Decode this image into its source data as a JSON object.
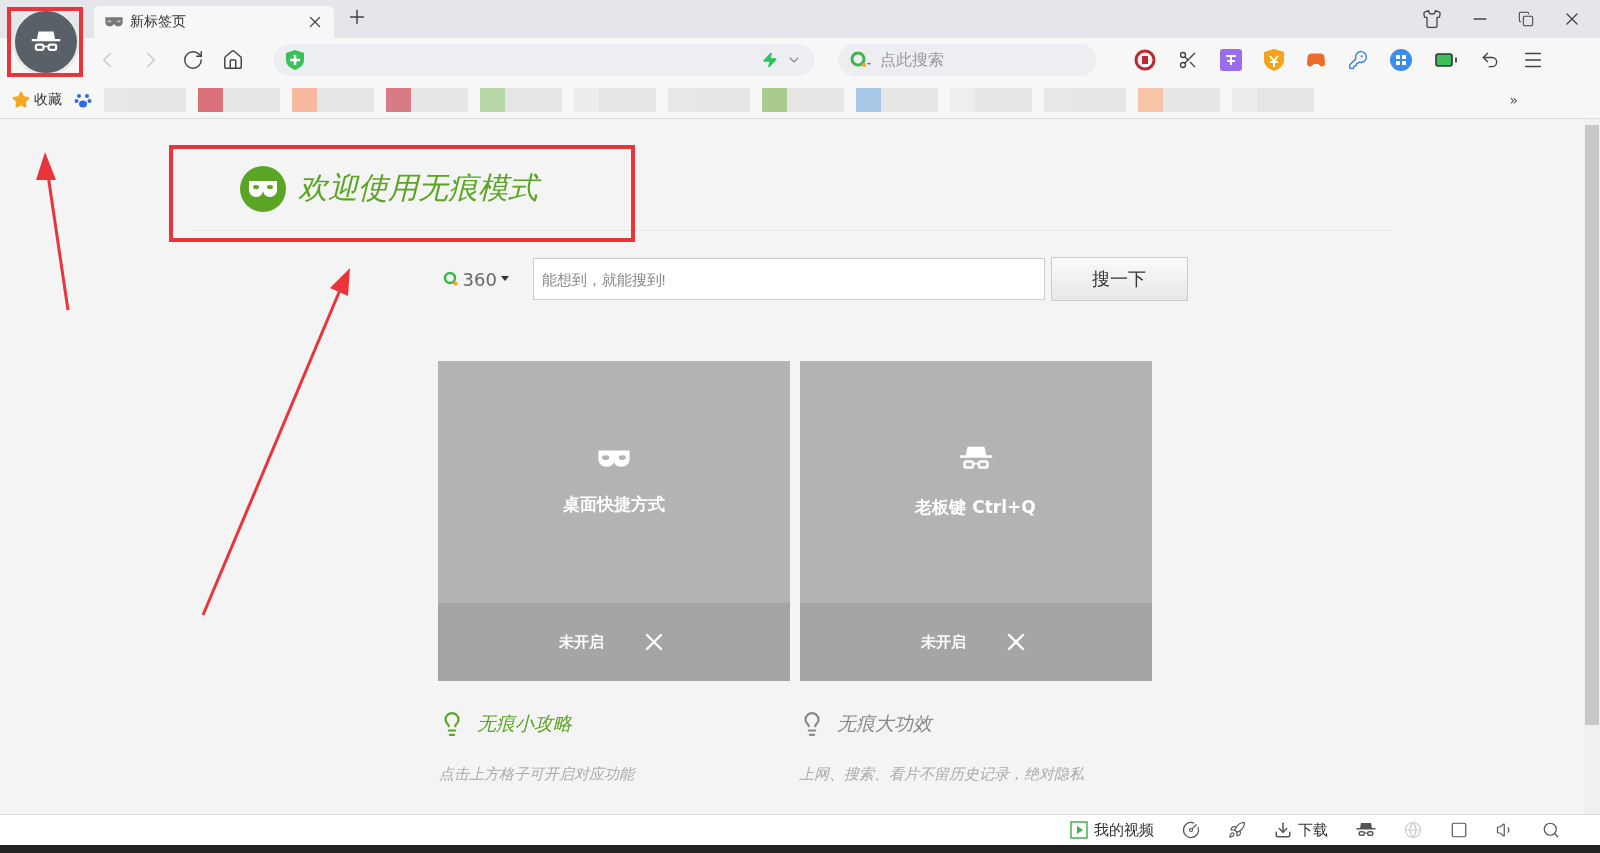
{
  "tab": {
    "title": "新标签页",
    "selected": true
  },
  "search_box": {
    "placeholder": "点此搜索"
  },
  "bookmarks_bar": {
    "favorites": "收藏",
    "more": "»"
  },
  "page": {
    "title": "欢迎使用无痕模式",
    "search": {
      "engine": "360",
      "placeholder": "能想到，就能搜到!",
      "button": "搜一下"
    },
    "tiles": [
      {
        "kind": "mask",
        "label": "桌面快捷方式",
        "status": "未开启",
        "on": false
      },
      {
        "kind": "boss",
        "label": "老板键 Ctrl+Q",
        "status": "未开启",
        "on": false
      }
    ],
    "tips": [
      {
        "title": "无痕小攻略",
        "color": "#5aa524",
        "line": "点击上方格子可开启对应功能"
      },
      {
        "title": "无痕大功效",
        "color": "#888888",
        "line": "上网、搜索、看片不留历史记录，绝对隐私"
      }
    ]
  },
  "status_bar": {
    "video": "我的视频",
    "download": "下载"
  }
}
